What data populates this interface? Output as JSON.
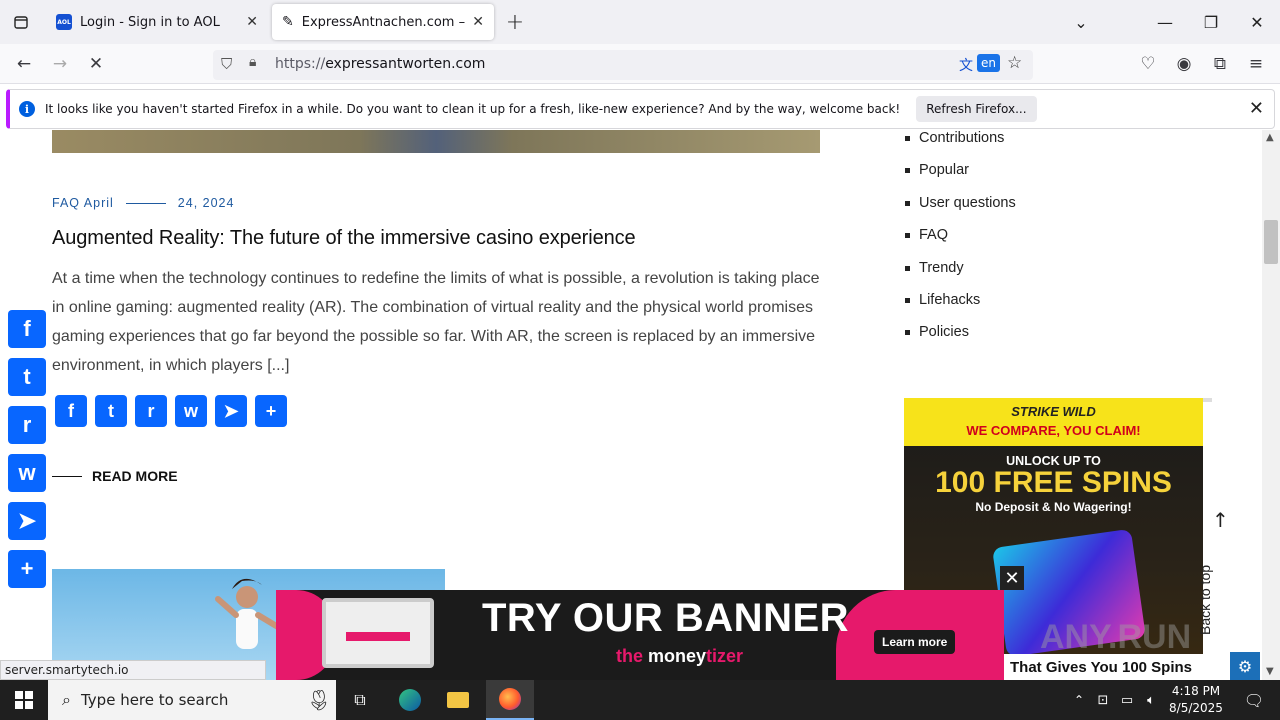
{
  "tabs": [
    {
      "title": "Login - Sign in to AOL",
      "icon": "aol-favicon"
    },
    {
      "title": "ExpressAntnachen.com – The m",
      "icon": "edit-favicon"
    }
  ],
  "urlbar": {
    "scheme": "https://",
    "host": "expressantworten.com",
    "translate_lang": "en"
  },
  "notification": {
    "text": "It looks like you haven't started Firefox in a while. Do you want to clean it up for a fresh, like-new experience? And by the way, welcome back!",
    "button": "Refresh Firefox..."
  },
  "article": {
    "category": "FAQ April",
    "date": "24, 2024",
    "title": "Augmented Reality: The future of the immersive casino experience",
    "excerpt": "At a time when the technology continues to redefine the limits of what is possible, a revolution is taking place in online gaming: augmented reality (AR). The combination of virtual reality and the physical world promises gaming experiences that go far beyond the possible so far. With AR, the screen is replaced by an immersive environment, in which players [...]",
    "read_more": "READ MORE"
  },
  "share_buttons": [
    "Facebook",
    "Twitter",
    "Reddit",
    "WhatsApp",
    "Telegram",
    "Share"
  ],
  "sidebar": {
    "items": [
      "Contributions",
      "Popular",
      "User questions",
      "FAQ",
      "Trendy",
      "Lifehacks",
      "Policies"
    ]
  },
  "ad_casino": {
    "logo": "STRIKE WILD",
    "claim": "WE COMPARE, YOU CLAIM!",
    "unlock": "UNLOCK UP TO",
    "spins": "100 FREE SPINS",
    "no_deposit": "No Deposit & No Wagering!",
    "tagline": "That Gives You 100 Spins"
  },
  "banner": {
    "headline": "TRY OUR BANNER",
    "cta": "Learn more",
    "brand_a": "the",
    "brand_b": "money",
    "brand_c": "tizer"
  },
  "back_to_top": "Back to top",
  "watermark": "ANY.RUN",
  "status_url": "server.smartytech.io",
  "taskbar": {
    "search_placeholder": "Type here to search",
    "time": "4:18 PM",
    "date": "8/5/2025"
  }
}
